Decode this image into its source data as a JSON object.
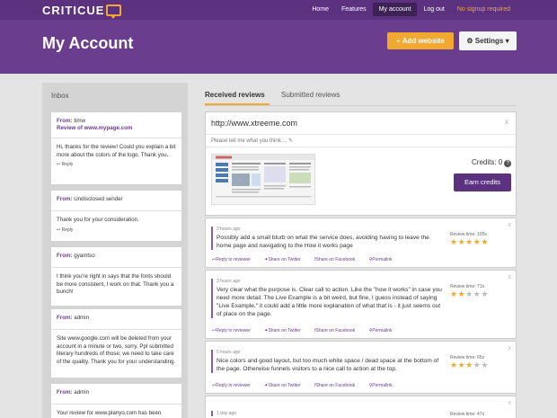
{
  "brand": {
    "name": "CRITICUE"
  },
  "nav": {
    "home": "Home",
    "features": "Features",
    "my_account": "My account",
    "logout": "Log out",
    "signup": "No signup required"
  },
  "header": {
    "title": "My Account",
    "add_website": "+ Add website",
    "settings": "Settings"
  },
  "inbox": {
    "title": "Inbox",
    "from_label": "From:",
    "reply_label": "Reply",
    "messages": [
      {
        "from": "timw",
        "subject": "Review of www.mypage.com",
        "body": "Hi, thanks for the review! Could you explain a bit more about the colors of the logo. Thank you."
      },
      {
        "from": "Undisclosed sender",
        "subject": "",
        "body": "Thank you for your consideration."
      },
      {
        "from": "gyamtso",
        "subject": "",
        "body": "I think you're right in says that the fonts should be more consistent, I work on that. Thank you a bunch!"
      },
      {
        "from": "admin",
        "subject": "",
        "body": "Site www.google.com will be deleted from your account in a minute or two, sorry. Ppl submitted literary hundreds of those; we need to take care of the quality. Thank you for your understanding."
      },
      {
        "from": "admin",
        "subject": "",
        "body": "Your review for www.planyo.com has been"
      }
    ]
  },
  "tabs": {
    "received": "Received reviews",
    "submitted": "Submitted reviews"
  },
  "site": {
    "url": "http://www.xtreeme.com",
    "close": "x",
    "prompt": "Please tell me what you think ...",
    "credits_label": "Credits: 0",
    "help": "?",
    "earn": "Earn credits"
  },
  "review_actions": {
    "reply": "Reply to reviewer",
    "twitter": "Share on Twitter",
    "facebook": "Share on Facebook",
    "permalink": "Permalink"
  },
  "reviews": [
    {
      "time": "3 hours ago",
      "text": "Possibly add a small blurb on what the service does, avoiding having to leave the home page and navigating to the How it works page",
      "review_time": "Review time: 105s",
      "rating": 5
    },
    {
      "time": "3 hours ago",
      "text": "Very clear what the purpose is. Clear call to action. Like the \"how it works\" in case you need more detail. The Live Example is a bit weird, but fine, I guess instead of saying \"Live Example,\" it could add a little more explanation of what that is - it just seems out of place on the page.",
      "review_time": "Review time: 71s",
      "rating": 2
    },
    {
      "time": "5 hours ago",
      "text": "Nice colors and good layout, but too much white space / dead space at the bottom of the page. Otherwise funnels visitors to a nice call to action at the top.",
      "review_time": "Review time: 65s",
      "rating": 3
    },
    {
      "time": "1 day ago",
      "text": "",
      "review_time": "Review time: 47s",
      "rating": 0
    }
  ],
  "colors": {
    "brand_purple": "#6b3d8e",
    "nav_purple": "#5c3180",
    "accent_orange": "#f0a830"
  }
}
